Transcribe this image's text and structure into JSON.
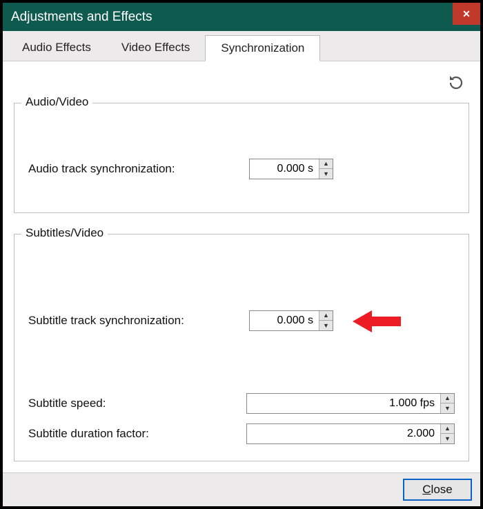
{
  "window": {
    "title": "Adjustments and Effects"
  },
  "tabs": {
    "audio_effects": "Audio Effects",
    "video_effects": "Video Effects",
    "synchronization": "Synchronization"
  },
  "groups": {
    "av": {
      "legend": "Audio/Video",
      "audio_sync_label": "Audio track synchronization:",
      "audio_sync_value": "0.000 s"
    },
    "sub": {
      "legend": "Subtitles/Video",
      "subtitle_sync_label": "Subtitle track synchronization:",
      "subtitle_sync_value": "0.000 s",
      "subtitle_speed_label": "Subtitle speed:",
      "subtitle_speed_value": "1.000 fps",
      "subtitle_duration_label": "Subtitle duration factor:",
      "subtitle_duration_value": "2.000"
    }
  },
  "buttons": {
    "close_u": "C",
    "close_rest": "lose"
  }
}
